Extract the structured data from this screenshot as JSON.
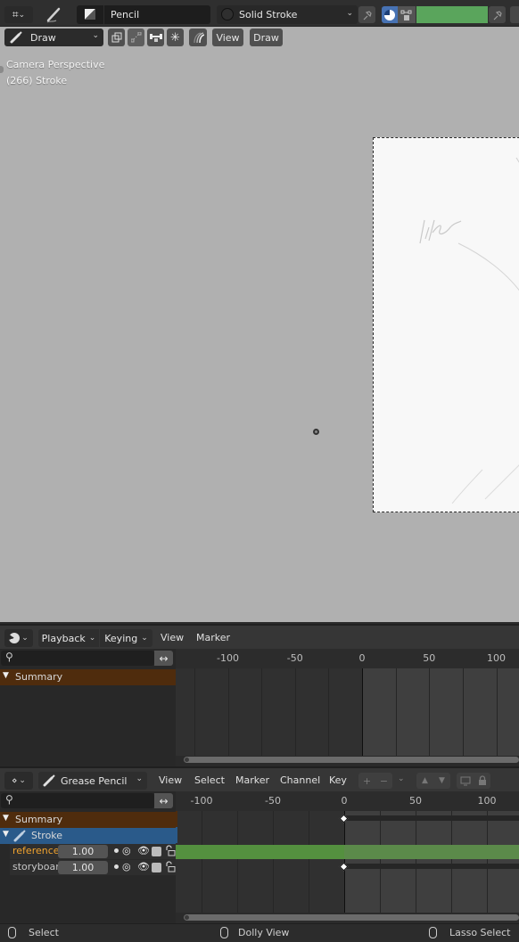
{
  "viewport_header": {
    "mode_icon": "grease-pencil-mode-icon",
    "tool_icon": "pencil-tool-icon",
    "brush_icon": "brush-preview-icon",
    "brush_name": "Pencil",
    "material_icon": "material-sphere-icon",
    "material_name": "Solid Stroke",
    "pin_icon": "pin-icon",
    "color_mode_icon": "color-material-icon",
    "vertex_color_icon": "vertex-color-icon",
    "color_swatch": "#5aa55c",
    "pin2_icon": "pin-icon"
  },
  "viewport_toolbar": {
    "mode_label": "Draw",
    "icons": [
      "stroke-placement-icon",
      "guides-icon",
      "sculpt-mask-icon",
      "snowflake-icon",
      "onion-skin-icon"
    ],
    "view_label": "View",
    "draw_label": "Draw"
  },
  "viewport": {
    "camera_label": "Camera Perspective",
    "object_label": "(266) Stroke",
    "sketch_text": "like"
  },
  "timeline": {
    "editor_icon": "clock-icon",
    "menus": {
      "playback": "Playback",
      "keying": "Keying",
      "view": "View",
      "marker": "Marker"
    },
    "search_placeholder": "",
    "swap_icon": "swap-arrows-icon",
    "ruler_ticks": [
      "-100",
      "-50",
      "0",
      "50",
      "100"
    ],
    "channels": [
      {
        "label": "Summary",
        "color": "#4f2c0d"
      }
    ]
  },
  "dopesheet": {
    "editor_icon": "dopesheet-icon",
    "mode_label": "Grease Pencil",
    "menus": {
      "view": "View",
      "select": "Select",
      "marker": "Marker",
      "channel": "Channel",
      "key": "Key"
    },
    "header_icons": [
      "plus-icon",
      "minus-icon",
      "chevron-down-icon",
      "move-up-icon",
      "move-down-icon",
      "display-icon",
      "lock-icon"
    ],
    "swap_icon": "swap-arrows-icon",
    "ruler_ticks": [
      "-100",
      "-50",
      "0",
      "50",
      "100"
    ],
    "summary_label": "Summary",
    "object_label": "Stroke",
    "layers": [
      {
        "name": "references",
        "opacity": "1.00",
        "active": true
      },
      {
        "name": "storyboard",
        "opacity": "1.00",
        "active": false
      }
    ]
  },
  "status_bar": {
    "left": "Select",
    "middle": "Dolly View",
    "right": "Lasso Select"
  }
}
